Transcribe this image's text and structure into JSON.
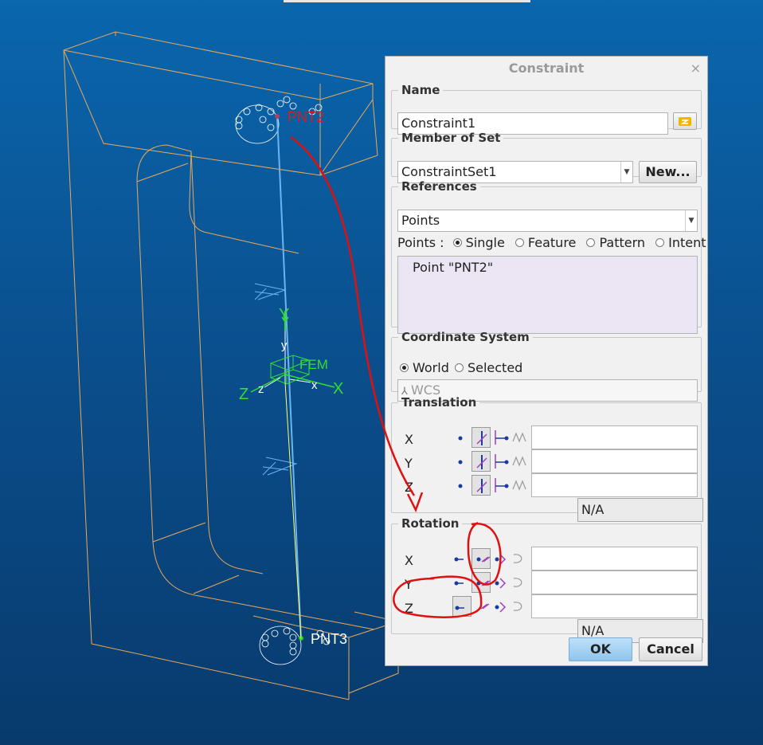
{
  "dialog": {
    "title": "Constraint",
    "close": "×",
    "name_section": {
      "legend": "Name",
      "value": "Constraint1"
    },
    "member_section": {
      "legend": "Member of Set",
      "value": "ConstraintSet1",
      "new_button": "New..."
    },
    "references_section": {
      "legend": "References",
      "type": "Points",
      "points_label": "Points :",
      "options": [
        "Single",
        "Feature",
        "Pattern",
        "Intent"
      ],
      "selected_option": "Single",
      "list": [
        "Point \"PNT2\""
      ]
    },
    "coord_section": {
      "legend": "Coordinate System",
      "world": "World",
      "selected": "Selected",
      "value": "WCS"
    },
    "translation_section": {
      "legend": "Translation",
      "rows": [
        "X",
        "Y",
        "Z"
      ],
      "na": "N/A"
    },
    "rotation_section": {
      "legend": "Rotation",
      "rows": [
        "X",
        "Y",
        "Z"
      ],
      "na": "N/A"
    },
    "ok_button": "OK",
    "cancel_button": "Cancel"
  },
  "viewport": {
    "point_top": "PNT2",
    "point_bottom": "PNT3",
    "axis_y": "Y",
    "axis_x": "X",
    "axis_z": "Z",
    "axis_y_small": "y",
    "axis_x_small": "x",
    "axis_z_small": "z",
    "csys_label": "FEM"
  },
  "colors": {
    "model_edges": "#e8a85a",
    "beam": "#6ab4f4",
    "axes": "#33dd33",
    "annotation": "#e01010"
  }
}
